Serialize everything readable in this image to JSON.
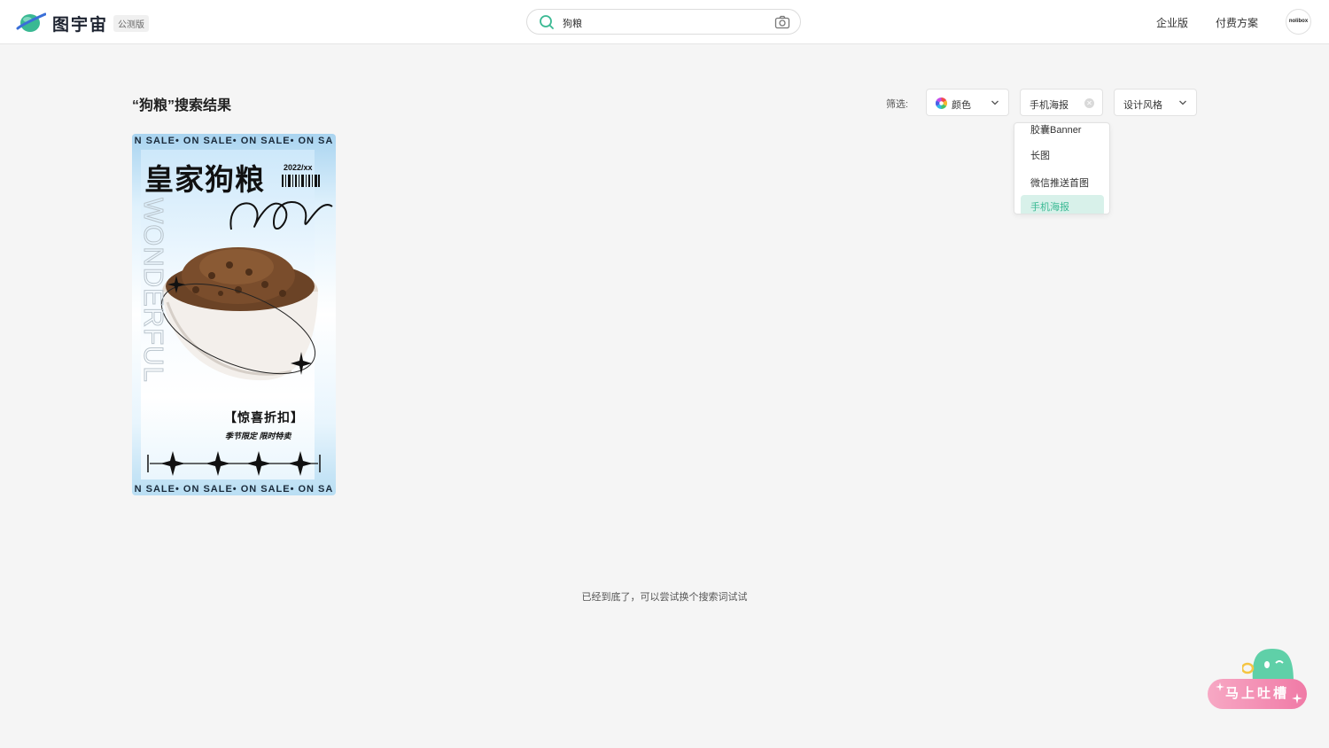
{
  "header": {
    "brand": "图宇宙",
    "beta_badge": "公测版",
    "search": {
      "value": "狗粮"
    },
    "nav": {
      "enterprise": "企业版",
      "pricing": "付费方案"
    },
    "avatar_text": "nolibox"
  },
  "results": {
    "title": "“狗粮”搜索结果",
    "end_message": "已经到底了，可以尝试换个搜索词试试"
  },
  "filters": {
    "label": "筛选:",
    "color": "颜色",
    "scene": "手机海报",
    "style": "设计风格",
    "menu_items": [
      "胶囊Banner",
      "长图",
      "微信推送首图",
      "手机海报"
    ],
    "active_item": "手机海报"
  },
  "poster": {
    "sale_strip": "N  SALE• ON  SALE• ON  SALE• ON  SA",
    "title": "皇家狗粮",
    "date": "2022/xx",
    "vertical_text": "WONDERFUL",
    "discount": "【惊喜折扣】",
    "limited": "季节限定  限时特卖"
  },
  "feedback": {
    "label": "马上吐槽"
  },
  "colors": {
    "accent": "#3ab993",
    "active_bg": "#d8f1ea",
    "feedback": "#f07aa6"
  }
}
